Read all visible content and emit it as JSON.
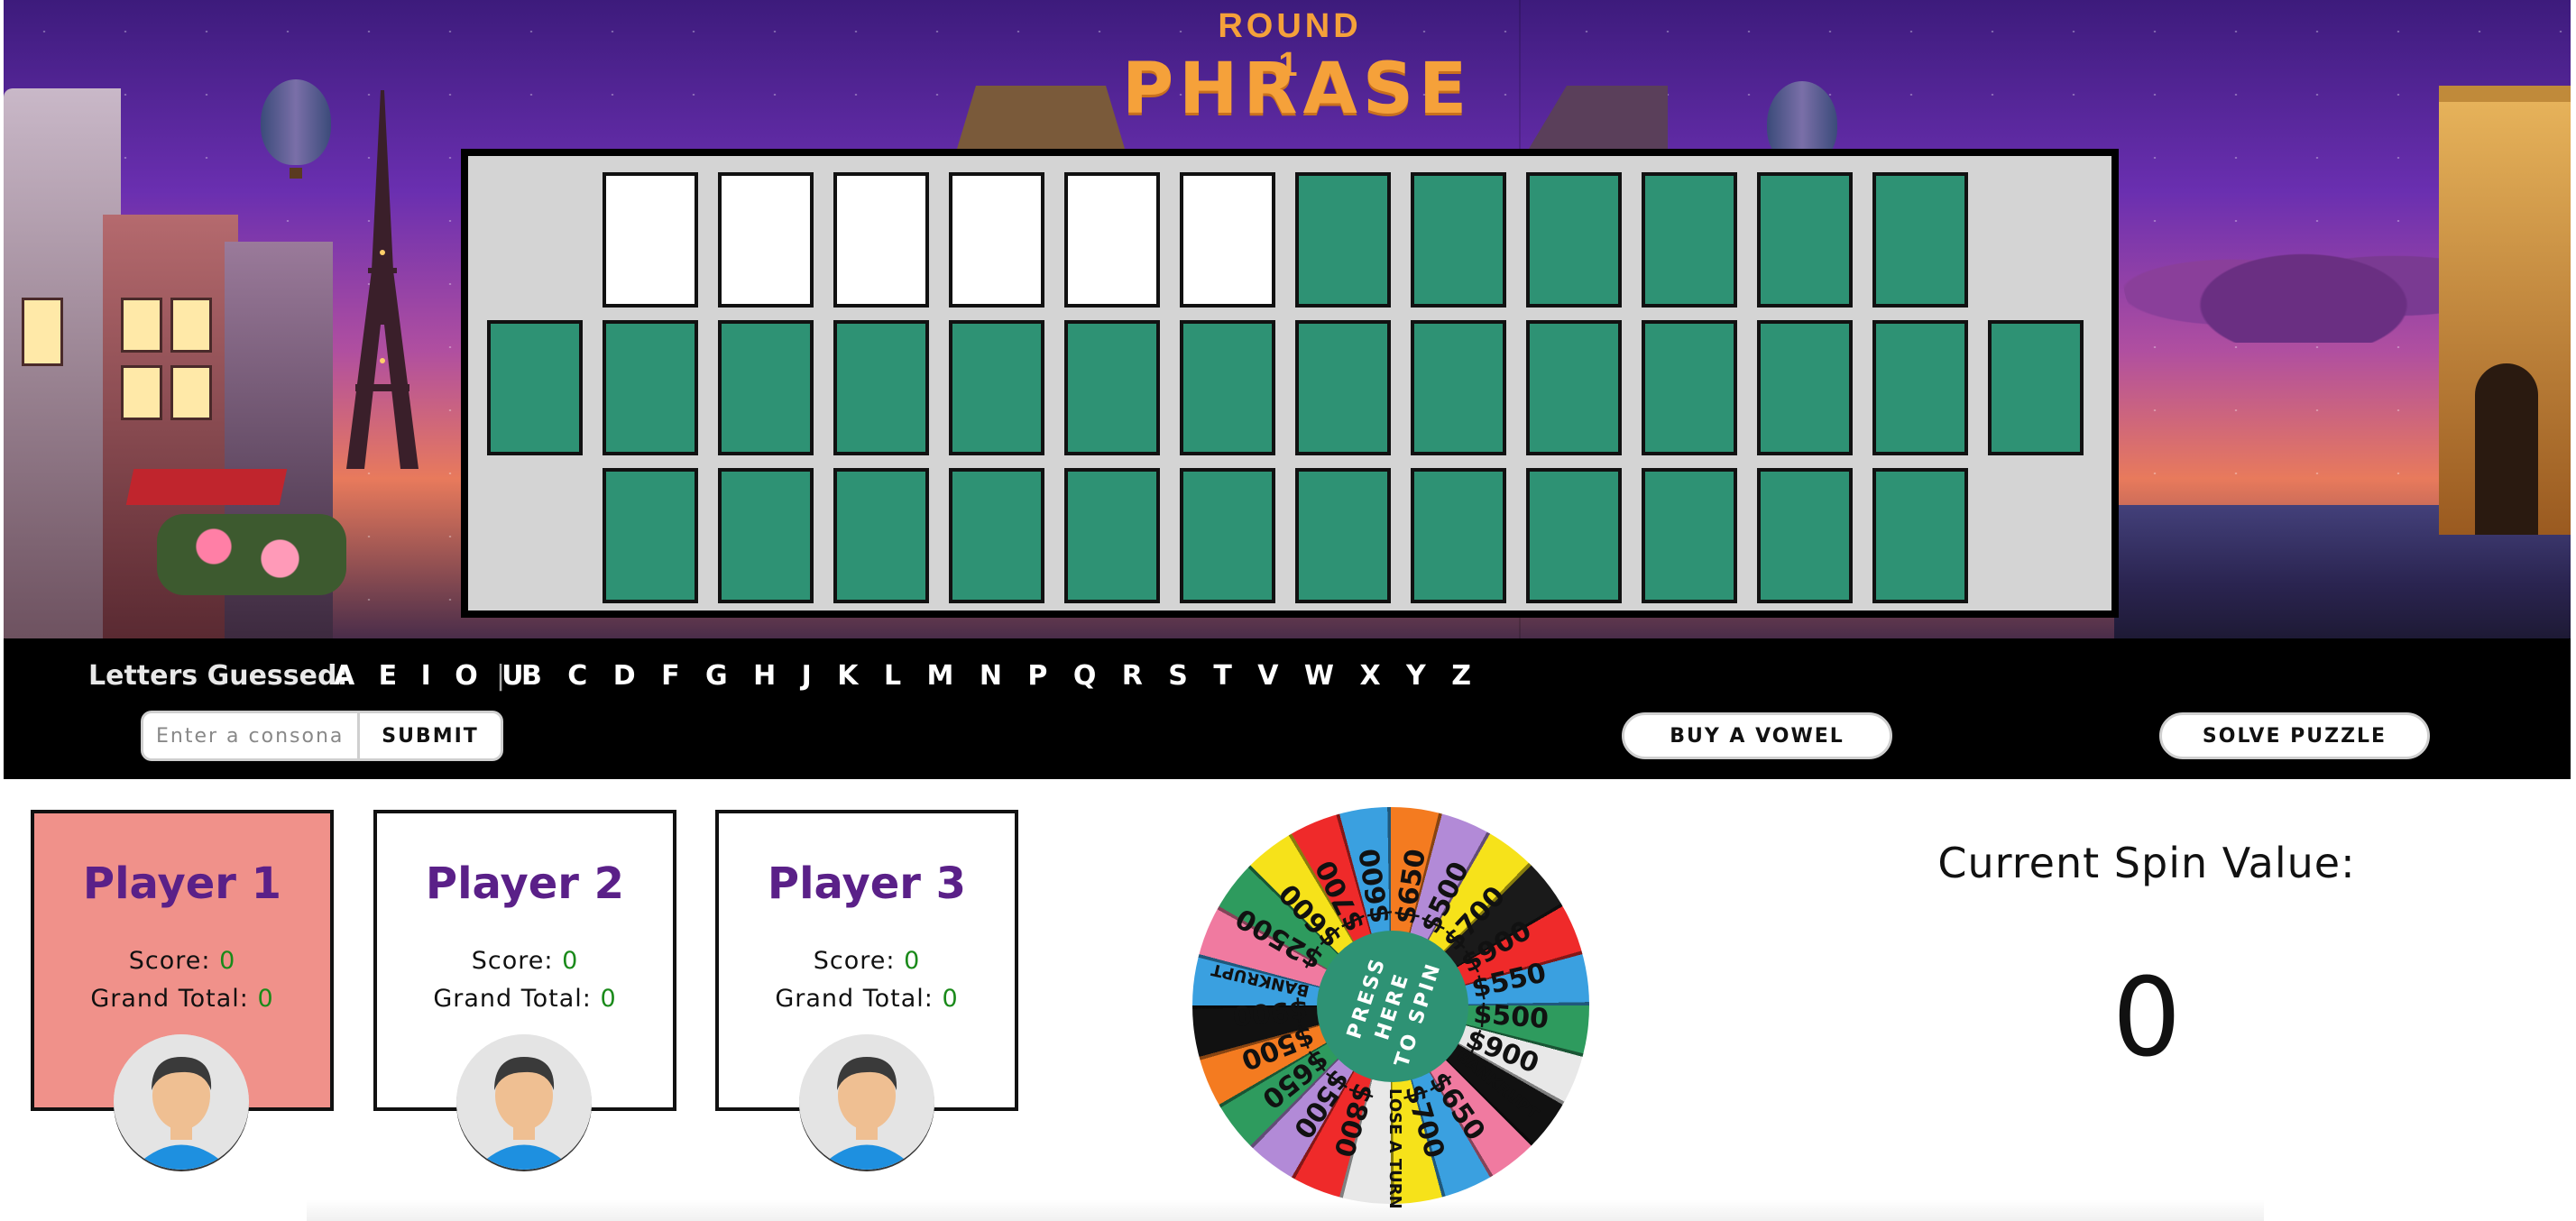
{
  "header": {
    "round_label": "ROUND 1",
    "category": "PHRASE"
  },
  "board": {
    "rows": [
      [
        "blank",
        "open",
        "open",
        "open",
        "open",
        "open",
        "open",
        "hidden",
        "hidden",
        "hidden",
        "hidden",
        "hidden",
        "hidden",
        "blank"
      ],
      [
        "hidden",
        "hidden",
        "hidden",
        "hidden",
        "hidden",
        "hidden",
        "hidden",
        "hidden",
        "hidden",
        "hidden",
        "hidden",
        "hidden",
        "hidden",
        "hidden"
      ],
      [
        "blank",
        "hidden",
        "hidden",
        "hidden",
        "hidden",
        "hidden",
        "hidden",
        "hidden",
        "hidden",
        "hidden",
        "hidden",
        "hidden",
        "hidden",
        "blank"
      ]
    ],
    "colors": {
      "hidden": "#2e9274",
      "open": "#ffffff",
      "board_bg": "#d4d4d4"
    }
  },
  "letters": {
    "label": "Letters Guessed:",
    "vowels": "A E I O U",
    "separator": "|",
    "consonants": "B C D F G H J K L M N P Q R S T V W X Y Z"
  },
  "controls": {
    "consonant_placeholder": "Enter a consonant",
    "consonant_value": "",
    "submit_label": "SUBMIT",
    "buy_vowel_label": "BUY A VOWEL",
    "solve_label": "SOLVE PUZZLE"
  },
  "players": [
    {
      "name": "Player 1",
      "score_label": "Score:",
      "score": "0",
      "total_label": "Grand Total:",
      "total": "0",
      "active": true
    },
    {
      "name": "Player 2",
      "score_label": "Score:",
      "score": "0",
      "total_label": "Grand Total:",
      "total": "0",
      "active": false
    },
    {
      "name": "Player 3",
      "score_label": "Score:",
      "score": "0",
      "total_label": "Grand Total:",
      "total": "0",
      "active": false
    }
  ],
  "wheel": {
    "center_text": "PRESS\nHERE\nTO SPIN",
    "wedges": [
      "$650",
      "$500",
      "$700",
      "$900",
      "$550",
      "$500",
      "$900",
      "BANKRUPT",
      "$650",
      "$700",
      "LOSE A TURN",
      "$800",
      "$500",
      "$650",
      "$500",
      "$900",
      "BANKRUPT",
      "$2500",
      "$600",
      "$700",
      "$600"
    ]
  },
  "spin": {
    "label": "Current Spin Value:",
    "value": "0"
  },
  "theme": {
    "accent_orange": "#f5a13a",
    "player_name_purple": "#5a2088",
    "active_player_bg": "#f0918a",
    "score_green": "#1a8a1a"
  }
}
